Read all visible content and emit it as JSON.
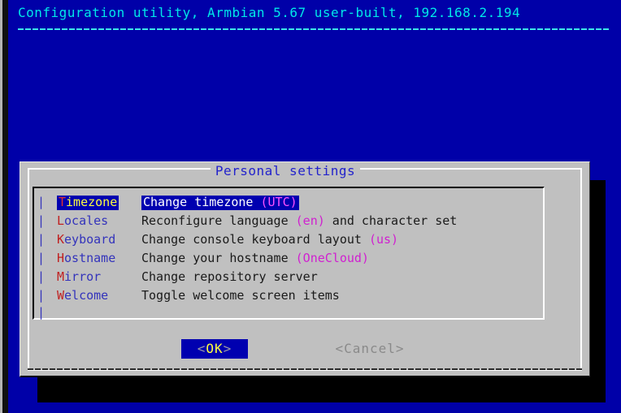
{
  "screen": {
    "background_color": "#0000a8",
    "foreground_color": "#00e8e8"
  },
  "header": {
    "title": "Configuration utility, Armbian 5.67 user-built, 192.168.2.194"
  },
  "dialog": {
    "title": "Personal settings",
    "background_color": "#c0c0c0",
    "title_color": "#2222cc",
    "highlight_color": "#0000b0"
  },
  "menu": {
    "bar_glyph": "|",
    "items": [
      {
        "tag_first": "T",
        "tag_rest": "imezone",
        "desc_prefix": "Change timezone ",
        "desc_value": "(UTC)",
        "desc_suffix": "",
        "selected": true
      },
      {
        "tag_first": "L",
        "tag_rest": "ocales",
        "desc_prefix": "Reconfigure language ",
        "desc_value": "(en)",
        "desc_suffix": " and character set",
        "selected": false
      },
      {
        "tag_first": "K",
        "tag_rest": "eyboard",
        "desc_prefix": "Change console keyboard layout ",
        "desc_value": "(us)",
        "desc_suffix": "",
        "selected": false
      },
      {
        "tag_first": "H",
        "tag_rest": "ostname",
        "desc_prefix": "Change your hostname ",
        "desc_value": "(OneCloud)",
        "desc_suffix": "",
        "selected": false
      },
      {
        "tag_first": "M",
        "tag_rest": "irror",
        "desc_prefix": "Change repository server",
        "desc_value": "",
        "desc_suffix": "",
        "selected": false
      },
      {
        "tag_first": "W",
        "tag_rest": "elcome",
        "desc_prefix": "Toggle welcome screen items",
        "desc_value": "",
        "desc_suffix": "",
        "selected": false
      }
    ]
  },
  "buttons": {
    "ok": {
      "left_bracket": "<",
      "label": "OK",
      "right_bracket": ">",
      "selected": true
    },
    "cancel": {
      "left_bracket": "<",
      "label": "Cancel",
      "right_bracket": ">",
      "selected": false
    }
  }
}
